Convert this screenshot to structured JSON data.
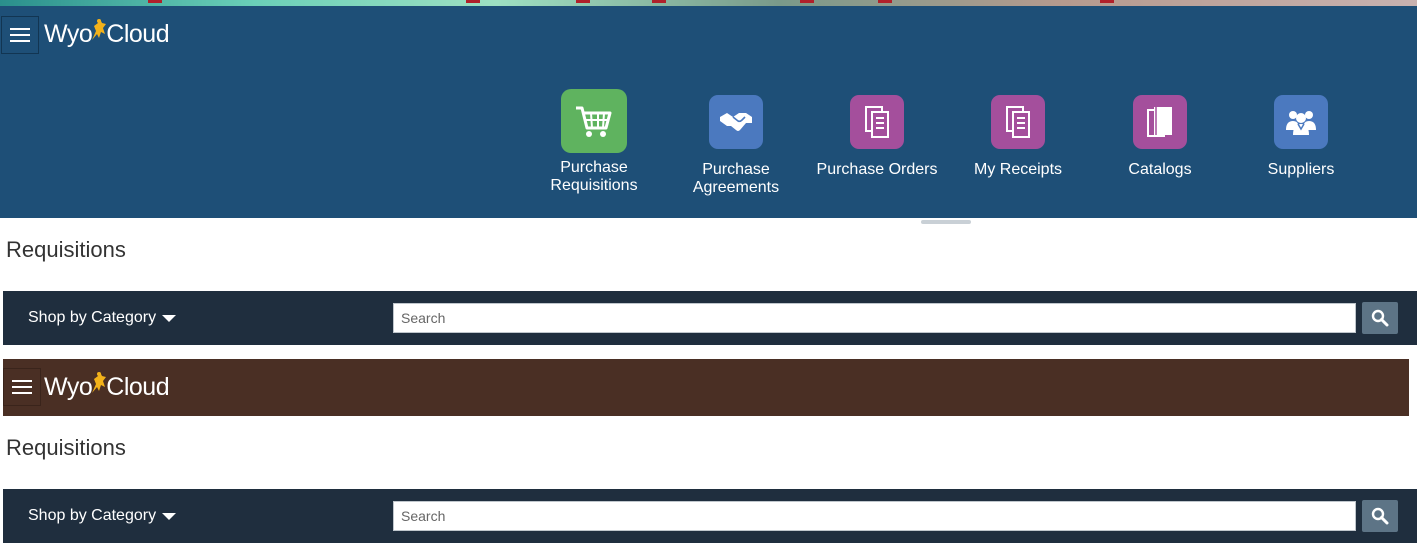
{
  "branding": {
    "logo_left": "Wyo",
    "logo_right": "Cloud"
  },
  "colors": {
    "springboard_bg": "#1e4f77",
    "brown_header_bg": "#4a2f24",
    "shopbar_bg": "#1f2e3e",
    "tile_green": "#5fb35f",
    "tile_blue": "#4b79bf",
    "tile_purple": "#a44f9c"
  },
  "springboard": {
    "apps": [
      {
        "label_line1": "Purchase",
        "label_line2": "Requisitions",
        "icon": "cart-icon",
        "color": "#5fb35f",
        "selected": true
      },
      {
        "label_line1": "Purchase",
        "label_line2": "Agreements",
        "icon": "handshake-icon",
        "color": "#4b79bf"
      },
      {
        "label_line1": "Purchase Orders",
        "label_line2": "",
        "icon": "document-icon",
        "color": "#a44f9c"
      },
      {
        "label_line1": "My Receipts",
        "label_line2": "",
        "icon": "document-icon",
        "color": "#a44f9c"
      },
      {
        "label_line1": "Catalogs",
        "label_line2": "",
        "icon": "books-icon",
        "color": "#a44f9c"
      },
      {
        "label_line1": "Suppliers",
        "label_line2": "",
        "icon": "people-icon",
        "color": "#4b79bf"
      }
    ]
  },
  "section1": {
    "title": "Requisitions",
    "shop_by_category": "Shop by Category",
    "search_placeholder": "Search"
  },
  "section2": {
    "title": "Requisitions",
    "shop_by_category": "Shop by Category",
    "search_placeholder": "Search"
  }
}
